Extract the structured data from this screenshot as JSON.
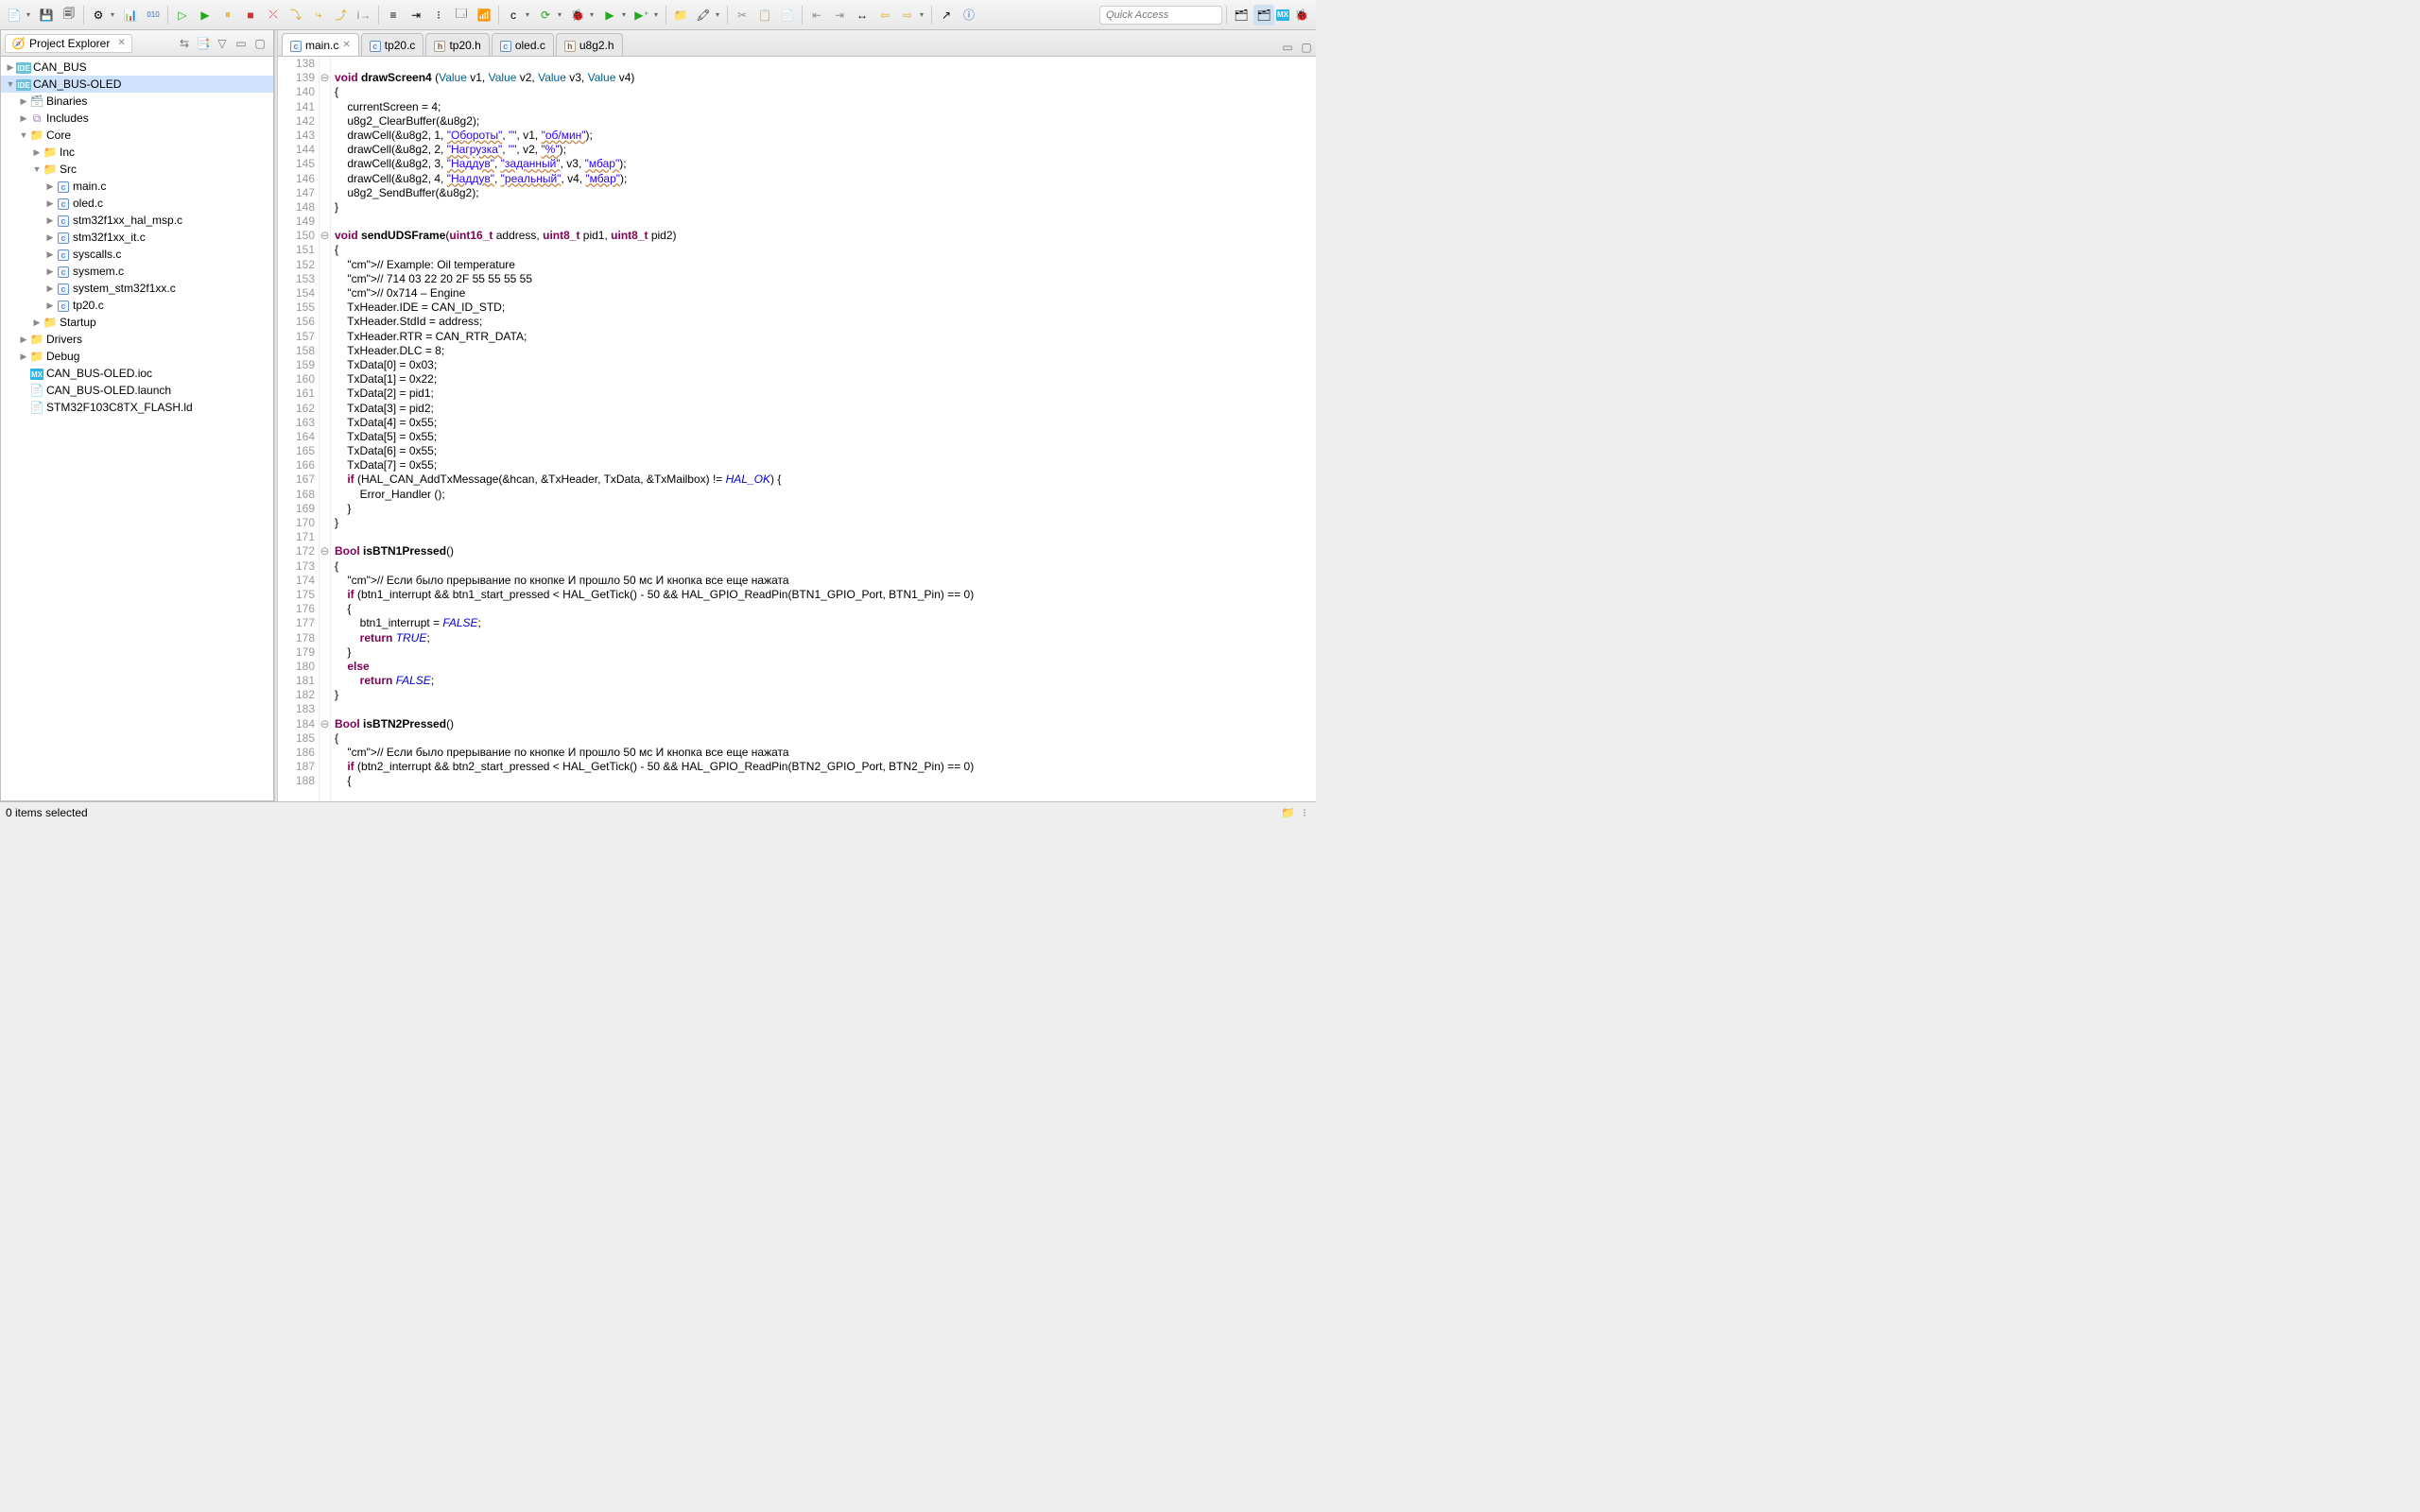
{
  "quick_access_placeholder": "Quick Access",
  "explorer": {
    "title": "Project Explorer",
    "tree": [
      {
        "d": 0,
        "arrow": "▶",
        "icon": "ide",
        "label": "CAN_BUS"
      },
      {
        "d": 0,
        "arrow": "▼",
        "icon": "ide",
        "label": "CAN_BUS-OLED",
        "sel": true
      },
      {
        "d": 1,
        "arrow": "▶",
        "icon": "bin",
        "label": "Binaries"
      },
      {
        "d": 1,
        "arrow": "▶",
        "icon": "inc",
        "label": "Includes"
      },
      {
        "d": 1,
        "arrow": "▼",
        "icon": "folder",
        "label": "Core"
      },
      {
        "d": 2,
        "arrow": "▶",
        "icon": "folder",
        "label": "Inc"
      },
      {
        "d": 2,
        "arrow": "▼",
        "icon": "folder",
        "label": "Src"
      },
      {
        "d": 3,
        "arrow": "▶",
        "icon": "c",
        "label": "main.c"
      },
      {
        "d": 3,
        "arrow": "▶",
        "icon": "c",
        "label": "oled.c"
      },
      {
        "d": 3,
        "arrow": "▶",
        "icon": "c",
        "label": "stm32f1xx_hal_msp.c"
      },
      {
        "d": 3,
        "arrow": "▶",
        "icon": "c",
        "label": "stm32f1xx_it.c"
      },
      {
        "d": 3,
        "arrow": "▶",
        "icon": "c",
        "label": "syscalls.c"
      },
      {
        "d": 3,
        "arrow": "▶",
        "icon": "c",
        "label": "sysmem.c"
      },
      {
        "d": 3,
        "arrow": "▶",
        "icon": "c",
        "label": "system_stm32f1xx.c"
      },
      {
        "d": 3,
        "arrow": "▶",
        "icon": "c",
        "label": "tp20.c"
      },
      {
        "d": 2,
        "arrow": "▶",
        "icon": "folder",
        "label": "Startup"
      },
      {
        "d": 1,
        "arrow": "▶",
        "icon": "folder",
        "label": "Drivers"
      },
      {
        "d": 1,
        "arrow": "▶",
        "icon": "folder",
        "label": "Debug"
      },
      {
        "d": 1,
        "arrow": "",
        "icon": "mx",
        "label": "CAN_BUS-OLED.ioc"
      },
      {
        "d": 1,
        "arrow": "",
        "icon": "gen",
        "label": "CAN_BUS-OLED.launch"
      },
      {
        "d": 1,
        "arrow": "",
        "icon": "gen",
        "label": "STM32F103C8TX_FLASH.ld"
      }
    ]
  },
  "tabs": [
    {
      "icon": "c",
      "label": "main.c",
      "active": true,
      "closable": true
    },
    {
      "icon": "c",
      "label": "tp20.c"
    },
    {
      "icon": "h",
      "label": "tp20.h"
    },
    {
      "icon": "c",
      "label": "oled.c"
    },
    {
      "icon": "h",
      "label": "u8g2.h"
    }
  ],
  "code_start": 138,
  "code": [
    "",
    "void drawScreen4 (Value v1, Value v2, Value v3, Value v4)",
    "{",
    "    currentScreen = 4;",
    "    u8g2_ClearBuffer(&u8g2);",
    "    drawCell(&u8g2, 1, \"Обороты\", \"\", v1, \"об/мин\");",
    "    drawCell(&u8g2, 2, \"Нагрузка\", \"\", v2, \"%\");",
    "    drawCell(&u8g2, 3, \"Наддув\", \"заданный\", v3, \"мбар\");",
    "    drawCell(&u8g2, 4, \"Наддув\", \"реальный\", v4, \"мбар\");",
    "    u8g2_SendBuffer(&u8g2);",
    "}",
    "",
    "void sendUDSFrame(uint16_t address, uint8_t pid1, uint8_t pid2)",
    "{",
    "    // Example: Oil temperature",
    "    // 714 03 22 20 2F 55 55 55 55",
    "    // 0x714 – Engine",
    "    TxHeader.IDE = CAN_ID_STD;",
    "    TxHeader.StdId = address;",
    "    TxHeader.RTR = CAN_RTR_DATA;",
    "    TxHeader.DLC = 8;",
    "    TxData[0] = 0x03;",
    "    TxData[1] = 0x22;",
    "    TxData[2] = pid1;",
    "    TxData[3] = pid2;",
    "    TxData[4] = 0x55;",
    "    TxData[5] = 0x55;",
    "    TxData[6] = 0x55;",
    "    TxData[7] = 0x55;",
    "    if (HAL_CAN_AddTxMessage(&hcan, &TxHeader, TxData, &TxMailbox) != HAL_OK) {",
    "        Error_Handler ();",
    "    }",
    "}",
    "",
    "Bool isBTN1Pressed()",
    "{",
    "    // Если было прерывание по кнопке И прошло 50 мс И кнопка все еще нажата",
    "    if (btn1_interrupt && btn1_start_pressed < HAL_GetTick() - 50 && HAL_GPIO_ReadPin(BTN1_GPIO_Port, BTN1_Pin) == 0)",
    "    {",
    "        btn1_interrupt = FALSE;",
    "        return TRUE;",
    "    }",
    "    else",
    "        return FALSE;",
    "}",
    "",
    "Bool isBTN2Pressed()",
    "{",
    "    // Если было прерывание по кнопке И прошло 50 мс И кнопка все еще нажата",
    "    if (btn2_interrupt && btn2_start_pressed < HAL_GetTick() - 50 && HAL_GPIO_ReadPin(BTN2_GPIO_Port, BTN2_Pin) == 0)",
    "    {"
  ],
  "fold_markers": {
    "139": "⊖",
    "150": "⊖",
    "172": "⊖",
    "184": "⊖"
  },
  "status": {
    "text": "0 items selected"
  }
}
